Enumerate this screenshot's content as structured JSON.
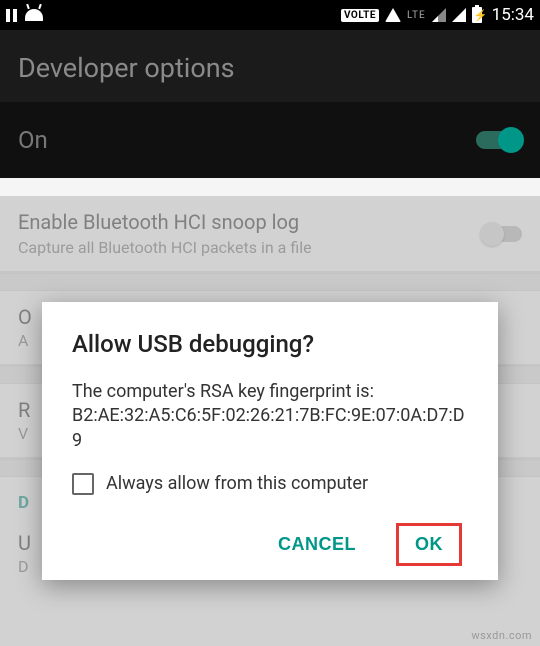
{
  "status_bar": {
    "time": "15:34",
    "volte": "VOLTE",
    "lte": "LTE"
  },
  "header": {
    "title": "Developer options"
  },
  "master": {
    "label": "On"
  },
  "rows": {
    "bt_hci": {
      "title": "Enable Bluetooth HCI snoop log",
      "subtitle": "Capture all Bluetooth HCI packets in a file"
    },
    "oem": {
      "title_initial": "O",
      "subtitle_initial": "A"
    },
    "running": {
      "title_initial": "R",
      "subtitle_initial": "V"
    },
    "usb": {
      "title_initial": "U",
      "subtitle_initial": "D"
    },
    "debug_section": "D"
  },
  "dialog": {
    "title": "Allow USB debugging?",
    "body": "The computer's RSA key fingerprint is:\nB2:AE:32:A5:C6:5F:02:26:21:7B:FC:9E:07:0A:D7:D9",
    "checkbox_label": "Always allow from this computer",
    "cancel": "CANCEL",
    "ok": "OK"
  },
  "watermark": "wsxdn.com"
}
